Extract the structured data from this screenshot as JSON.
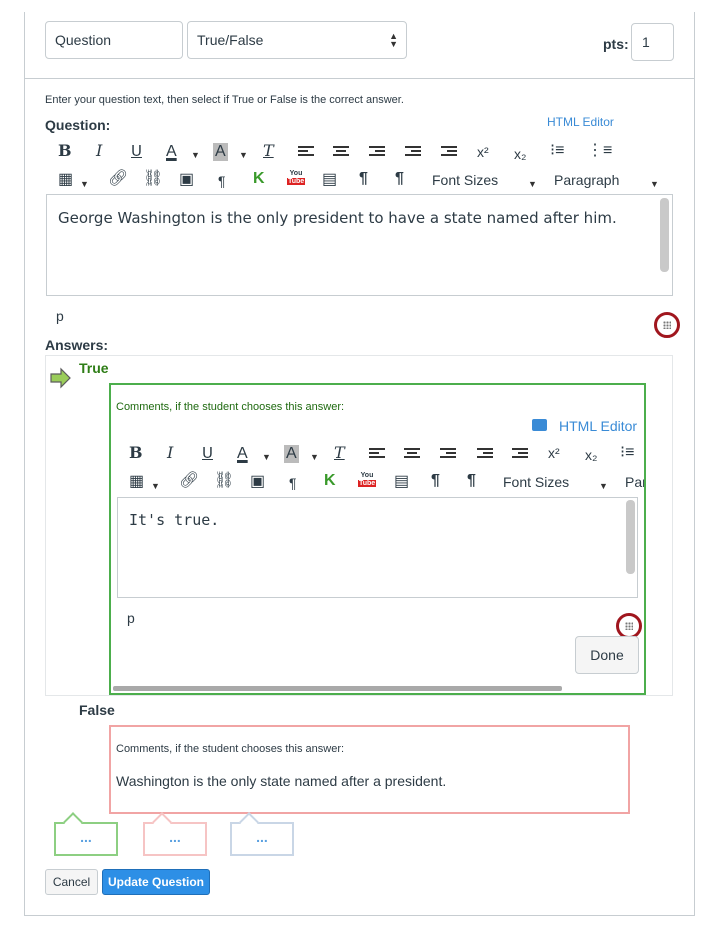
{
  "question": {
    "name": "Question",
    "type": "True/False",
    "pts_label": "pts:",
    "pts": "1",
    "instructions": "Enter your question text, then select if True or False is the correct answer.",
    "label": "Question:",
    "html_editor_link": "HTML Editor",
    "text": "George Washington is the only president to have a state named after him.",
    "path": "p"
  },
  "toolbar": {
    "bold": "B",
    "italic": "I",
    "underline": "U",
    "font_color": "A",
    "bg_color": "A",
    "clear_format": "T",
    "superscript": "x²",
    "subscript": "x₂",
    "pilcrow": "¶",
    "font_sizes": "Font Sizes",
    "paragraph": "Paragraph",
    "paragraph_cut": "Par",
    "youtube_top": "You",
    "youtube_bottom": "Tube"
  },
  "answers": {
    "label": "Answers:",
    "true": {
      "label": "True",
      "comments_label": "Comments, if the student chooses this answer:",
      "html_editor_link": "HTML Editor",
      "text": "It's true.",
      "path": "p",
      "done_label": "Done"
    },
    "false": {
      "label": "False",
      "comments_label": "Comments, if the student chooses this answer:",
      "text": "Washington is the only state named after a president."
    }
  },
  "bubbles": [
    "...",
    "...",
    "..."
  ],
  "actions": {
    "cancel": "Cancel",
    "update": "Update Question"
  },
  "colors": {
    "accent_blue": "#2d8fe6",
    "correct_green": "#4cae4c",
    "incorrect_red": "#f1a4a4",
    "highlight_ring": "#a0161e"
  }
}
